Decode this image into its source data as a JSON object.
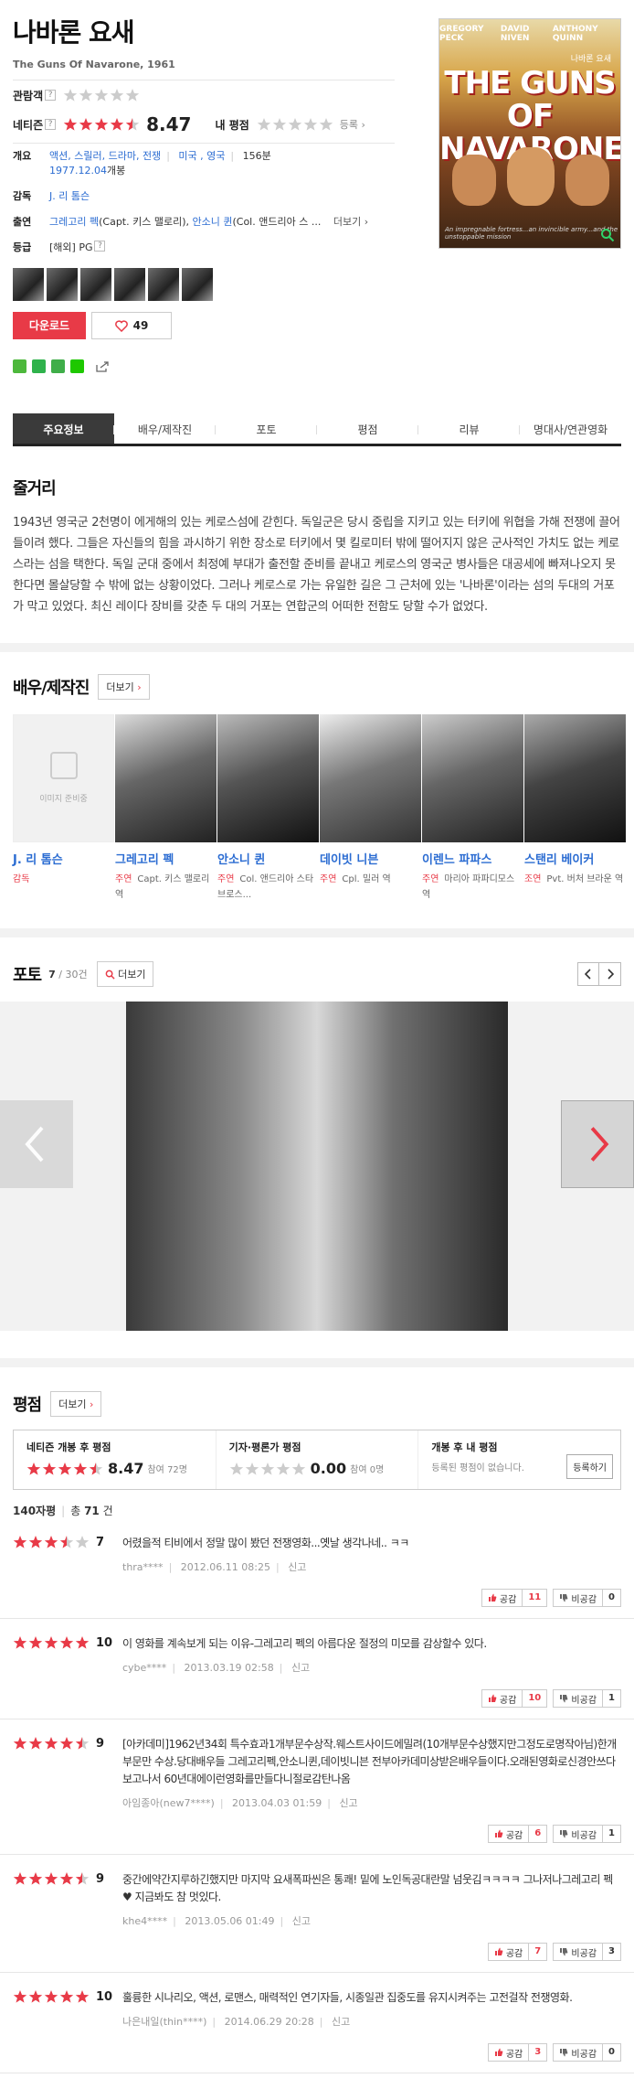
{
  "header": {
    "title": "나바론 요새",
    "subtitle": "The Guns Of Navarone, 1961",
    "audience_label": "관람객",
    "netizen_label": "네티즌",
    "netizen_score": "8.47",
    "netizen_stars": 4.5,
    "my_rating_label": "내 평점",
    "register": "등록",
    "q": "?"
  },
  "info": {
    "overview_label": "개요",
    "genres": "액션, 스릴러, 드라마, 전쟁",
    "countries": "미국 , 영국",
    "runtime": "156분",
    "release": "1977.12.04",
    "release_suffix": "개봉",
    "director_label": "감독",
    "director": "J. 리 톰슨",
    "cast_label": "출연",
    "cast1": "그레고리 펙",
    "cast1_role": "(Capt. 키스 맬로리)",
    "cast2": "안소니 퀸",
    "cast2_role": "(Col. 앤드리아 스 ...",
    "more": "더보기",
    "grade_label": "등급",
    "grade": "[해외] PG"
  },
  "poster": {
    "names": [
      "GREGORY PECK",
      "DAVID NIVEN",
      "ANTHONY QUINN"
    ],
    "title": "THE GUNS OF NAVARONE",
    "korean": "나바론 요새",
    "tagline": "An impregnable fortress...an invincible army...and the unstoppable mission"
  },
  "actions": {
    "download": "다운로드",
    "likes": "49"
  },
  "tabs": [
    "주요정보",
    "배우/제작진",
    "포토",
    "평점",
    "리뷰",
    "명대사/연관영화"
  ],
  "plot": {
    "title": "줄거리",
    "text": "1943년 영국군 2천명이 에게해의 있는 케로스섬에 갇힌다. 독일군은 당시 중립을 지키고 있는 터키에 위협을 가해 전쟁에 끌어들이려 했다. 그들은 자신들의 힘을 과시하기 위한 장소로 터키에서 몇 킬로미터 밖에 떨어지지 않은 군사적인 가치도 없는 케로스라는 섬을 택한다. 독일 군대 중에서 최정예 부대가 출전할 준비를 끝내고 케로스의 영국군 병사들은 대공세에 빠져나오지 못한다면 몰살당할 수 밖에 없는 상황이었다. 그러나 케로스로 가는 유일한 길은 그 근처에 있는 '나바론'이라는 섬의 두대의 거포가 막고 있었다. 최신 레이다 장비를 갖춘 두 대의 거포는 연합군의 어떠한 전함도 당할 수가 없었다."
  },
  "cast_section": {
    "title": "배우/제작진",
    "more": "더보기",
    "noimage": "이미지 준비중",
    "people": [
      {
        "name": "J. 리 톰슨",
        "type": "감독",
        "role": ""
      },
      {
        "name": "그레고리 펙",
        "type": "주연",
        "role": "Capt. 키스 맬로리 역"
      },
      {
        "name": "안소니 퀸",
        "type": "주연",
        "role": "Col. 앤드리아 스타브로스..."
      },
      {
        "name": "데이빗 니븐",
        "type": "주연",
        "role": "Cpl. 밀러 역"
      },
      {
        "name": "이렌느 파파스",
        "type": "주연",
        "role": "마리아 파파디모스 역"
      },
      {
        "name": "스탠리 베이커",
        "type": "조연",
        "role": "Pvt. 버처 브라운 역"
      }
    ]
  },
  "photo_section": {
    "title": "포토",
    "current": "7",
    "total": "/ 30건",
    "more": "더보기"
  },
  "rating_section": {
    "title": "평점",
    "more": "더보기",
    "netizen_head": "네티즌 개봉 후 평점",
    "netizen_score": "8.47",
    "netizen_count": "참여 72명",
    "critic_head": "기자·평론가 평점",
    "critic_score": "0.00",
    "critic_count": "참여 0명",
    "pre_head": "개봉 후 내 평점",
    "pre_text": "등록된 평점이 없습니다.",
    "register": "등록하기",
    "count_label": "140자평",
    "total_label": "총",
    "total": "71",
    "total_unit": "건"
  },
  "reviews": [
    {
      "score": "7",
      "stars": 3.5,
      "text": "어렸을적 티비에서 정말 많이 봤던 전쟁영화...옛날 생각나네.. ㅋㅋ",
      "user": "thra****",
      "date": "2012.06.11 08:25",
      "report": "신고",
      "up": "11",
      "down": "0"
    },
    {
      "score": "10",
      "stars": 5,
      "text": "이 영화를 계속보게 되는 이유-그레고리 펙의 아름다운 절정의 미모를 감상할수 있다.",
      "user": "cybe****",
      "date": "2013.03.19 02:58",
      "report": "신고",
      "up": "10",
      "down": "1"
    },
    {
      "score": "9",
      "stars": 4.5,
      "text": "[아카데미]1962년34회 특수효과1개부문수상작.웨스트사이드에밀려(10개부문수상했지만그정도로명작아님)한개부문만 수상.당대배우들 그레고리펙,안소니퀸,데이빗니븐 전부아카데미상받은배우들이다.오래된영화로신경안쓰다 보고나서 60년대에이런영화를만들다니절로감탄나옴",
      "user": "아임종아(new7****)",
      "date": "2013.04.03 01:59",
      "report": "신고",
      "up": "6",
      "down": "1"
    },
    {
      "score": "9",
      "stars": 4.5,
      "text": "중간에약간지루하긴했지만 마지막 요새폭파씬은 통쾌! 밑에 노인독공대란말 넘웃김ㅋㅋㅋㅋ 그나저나그레고리 펙♥ 지금봐도 참 멋있다.",
      "user": "khe4****",
      "date": "2013.05.06 01:49",
      "report": "신고",
      "up": "7",
      "down": "3"
    },
    {
      "score": "10",
      "stars": 5,
      "text": "훌륭한 시나리오, 액션, 로맨스, 매력적인 연기자들, 시종일관 집중도를 유지시켜주는 고전걸작 전쟁영화.",
      "user": "나은내일(thin****)",
      "date": "2014.06.29 20:28",
      "report": "신고",
      "up": "3",
      "down": "0"
    }
  ],
  "vote_labels": {
    "up": "공감",
    "down": "비공감"
  },
  "colors": {
    "star_red": "#e83a47",
    "star_gray": "#cccccc",
    "link": "#2b6cd2",
    "tab_active": "#3a3a3a"
  }
}
